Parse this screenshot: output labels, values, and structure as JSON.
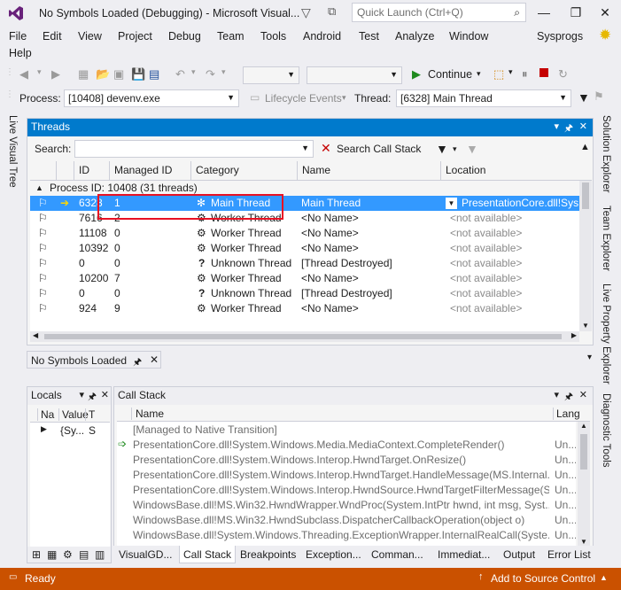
{
  "window": {
    "title": "No Symbols Loaded (Debugging) - Microsoft Visual...",
    "quick_launch_placeholder": "Quick Launch (Ctrl+Q)",
    "minimize": "—",
    "restore": "❐",
    "close": "✕"
  },
  "menu": {
    "items": [
      "File",
      "Edit",
      "View",
      "Project",
      "Debug",
      "Team",
      "Tools",
      "Android",
      "Test",
      "Analyze",
      "Window",
      "Help"
    ],
    "user": "Sysprogs"
  },
  "toolbar": {
    "continue_label": "Continue",
    "process_label": "Process:",
    "process_value": "[10408] devenv.exe",
    "lifecycle_label": "Lifecycle Events",
    "thread_label": "Thread:",
    "thread_value": "[6328] Main Thread"
  },
  "left_tabs": {
    "live_visual_tree": "Live Visual Tree"
  },
  "right_tabs": [
    "Solution Explorer",
    "Team Explorer",
    "Live Property Explorer",
    "Diagnostic Tools"
  ],
  "threads": {
    "title": "Threads",
    "search_label": "Search:",
    "search_value": "",
    "search_call_stack": "Search Call Stack",
    "columns": [
      "ID",
      "Managed ID",
      "Category",
      "Name",
      "Location"
    ],
    "group_label": "Process ID: 10408  (31 threads)",
    "rows": [
      {
        "id": "6328",
        "managed": "1",
        "category": "Main Thread",
        "name": "Main Thread",
        "location": "PresentationCore.dll!Sys..."
      },
      {
        "id": "7616",
        "managed": "2",
        "category": "Worker Thread",
        "name": "<No Name>",
        "location": "<not available>"
      },
      {
        "id": "11108",
        "managed": "0",
        "category": "Worker Thread",
        "name": "<No Name>",
        "location": "<not available>"
      },
      {
        "id": "10392",
        "managed": "0",
        "category": "Worker Thread",
        "name": "<No Name>",
        "location": "<not available>"
      },
      {
        "id": "0",
        "managed": "0",
        "category": "Unknown Thread",
        "name": "[Thread Destroyed]",
        "location": "<not available>"
      },
      {
        "id": "10200",
        "managed": "7",
        "category": "Worker Thread",
        "name": "<No Name>",
        "location": "<not available>"
      },
      {
        "id": "0",
        "managed": "0",
        "category": "Unknown Thread",
        "name": "[Thread Destroyed]",
        "location": "<not available>"
      },
      {
        "id": "924",
        "managed": "9",
        "category": "Worker Thread",
        "name": "<No Name>",
        "location": "<not available>"
      }
    ]
  },
  "no_symbols_tab": "No Symbols Loaded",
  "locals": {
    "title": "Locals",
    "columns": [
      "Na",
      "Value",
      "T"
    ],
    "row": {
      "value": "{Sy...",
      "type": "S"
    }
  },
  "callstack": {
    "title": "Call Stack",
    "columns": [
      "Name",
      "Lang"
    ],
    "rows": [
      {
        "name": "[Managed to Native Transition]",
        "lang": ""
      },
      {
        "name": "PresentationCore.dll!System.Windows.Media.MediaContext.CompleteRender()",
        "lang": "Un..."
      },
      {
        "name": "PresentationCore.dll!System.Windows.Interop.HwndTarget.OnResize()",
        "lang": "Un..."
      },
      {
        "name": "PresentationCore.dll!System.Windows.Interop.HwndTarget.HandleMessage(MS.Internal...",
        "lang": "Un..."
      },
      {
        "name": "PresentationCore.dll!System.Windows.Interop.HwndSource.HwndTargetFilterMessage(S...",
        "lang": "Un..."
      },
      {
        "name": "WindowsBase.dll!MS.Win32.HwndWrapper.WndProc(System.IntPtr hwnd, int msg, Syst...",
        "lang": "Un..."
      },
      {
        "name": "WindowsBase.dll!MS.Win32.HwndSubclass.DispatcherCallbackOperation(object o)",
        "lang": "Un..."
      },
      {
        "name": "WindowsBase.dll!System.Windows.Threading.ExceptionWrapper.InternalRealCall(Syste...",
        "lang": "Un..."
      }
    ]
  },
  "bottom_tabs": [
    "VisualGD...",
    "Call Stack",
    "Breakpoints",
    "Exception...",
    "Comman...",
    "Immediat...",
    "Output",
    "Error List"
  ],
  "status": {
    "left": "Ready",
    "right": "Add to Source Control"
  },
  "colors": {
    "accent": "#007acc",
    "status": "#ca5100",
    "highlight": "#e81123",
    "selection": "#3399ff"
  }
}
